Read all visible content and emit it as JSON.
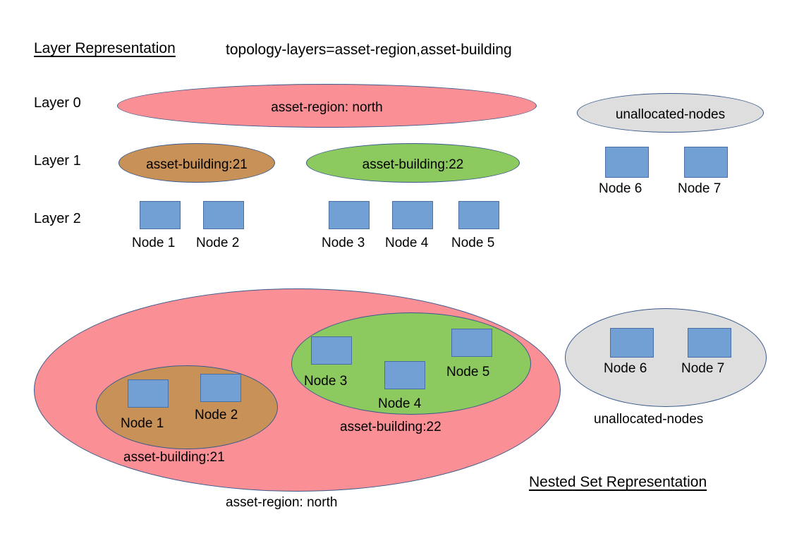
{
  "diagram": {
    "layer_section": {
      "title": "Layer Representation",
      "config": "topology-layers=asset-region,asset-building",
      "layers": [
        {
          "label": "Layer 0"
        },
        {
          "label": "Layer 1"
        },
        {
          "label": "Layer 2"
        }
      ],
      "region_ellipse": "asset-region: north",
      "unallocated_ellipse": "unallocated-nodes",
      "building_21": "asset-building:21",
      "building_22": "asset-building:22",
      "nodes": [
        {
          "label": "Node 1"
        },
        {
          "label": "Node 2"
        },
        {
          "label": "Node 3"
        },
        {
          "label": "Node 4"
        },
        {
          "label": "Node 5"
        },
        {
          "label": "Node 6"
        },
        {
          "label": "Node 7"
        }
      ]
    },
    "nested_section": {
      "title": "Nested Set Representation",
      "region_label": "asset-region: north",
      "building_21_label": "asset-building:21",
      "building_22_label": "asset-building:22",
      "unallocated_label": "unallocated-nodes",
      "nodes": [
        {
          "label": "Node 1"
        },
        {
          "label": "Node 2"
        },
        {
          "label": "Node 3"
        },
        {
          "label": "Node 4"
        },
        {
          "label": "Node 5"
        },
        {
          "label": "Node 6"
        },
        {
          "label": "Node 7"
        }
      ]
    },
    "colors": {
      "region": "#fa9096",
      "building_21": "#c89158",
      "building_22": "#8cc95f",
      "unallocated": "#dedede",
      "node": "#729fd4",
      "stroke": "#3a5a8c"
    }
  }
}
